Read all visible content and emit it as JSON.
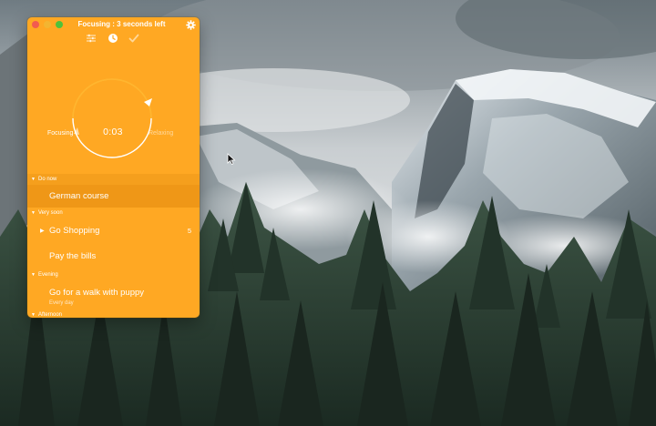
{
  "window": {
    "title": "Focusing : 3 seconds left"
  },
  "timer": {
    "mode_left": "Focusing",
    "mode_right": "Relaxing",
    "countdown": "0:03"
  },
  "sections": [
    {
      "header": "Do now",
      "tasks": [
        {
          "label": "German course",
          "active": true
        }
      ]
    },
    {
      "header": "Very soon",
      "tasks": [
        {
          "label": "Go Shopping",
          "count": "5",
          "expandable": true
        },
        {
          "label": "Pay the bills"
        }
      ]
    },
    {
      "header": "Evening",
      "tasks": [
        {
          "label": "Go for a walk with puppy",
          "subtitle": "Every day"
        }
      ]
    },
    {
      "header": "Afternoon",
      "tasks": []
    }
  ],
  "icons": {
    "close": "close-button",
    "minimize": "minimize-button",
    "maximize": "maximize-button",
    "settings": "gear-icon",
    "task_list": "list-icon",
    "timer": "clock-icon",
    "done": "checkmark-icon",
    "disclosure": "triangle-down-icon",
    "pointer": "arrow-cursor-icon"
  },
  "colors": {
    "accent": "#ffa823",
    "active_row": "#ef9717",
    "close": "#f25b4f",
    "minimize": "#f3b531",
    "maximize": "#4fc23a"
  }
}
